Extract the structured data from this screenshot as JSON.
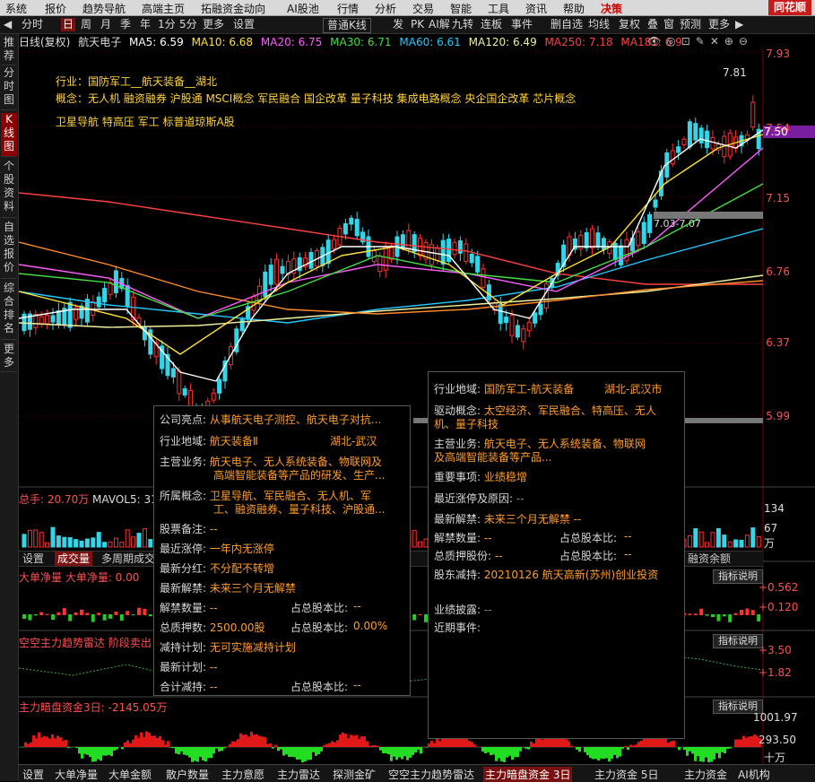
{
  "menu": [
    "系统",
    "报价",
    "趋势导航",
    "高端主页",
    "拓融资金动向",
    "AI股池",
    "行情",
    "分析",
    "交易",
    "智能",
    "工具",
    "资讯",
    "帮助",
    "决策"
  ],
  "brand": "同花顺",
  "toolbar": {
    "items": [
      "分时",
      "日",
      "周",
      "月",
      "季",
      "年",
      "1分",
      "5分",
      "更多",
      "设置"
    ],
    "active": "日",
    "right_items": [
      "普通K线",
      "发",
      "PK",
      "AI解",
      "九转",
      "连板",
      "事件",
      "删自选",
      "均线",
      "复权",
      "叠",
      "窗",
      "预测",
      "更多"
    ]
  },
  "left_tabs": [
    "推荐",
    "分时图",
    "K线图",
    "个股资料",
    "自选报价",
    "综合排名",
    "更多"
  ],
  "left_tabs_active": "K线图",
  "chart_header": {
    "mode": "日线(复权)",
    "name": "航天电子",
    "ma5": "MA5: 6.59",
    "ma10": "MA10: 6.68",
    "ma20": "MA20: 6.75",
    "ma30": "MA30: 6.71",
    "ma60": "MA60: 6.61",
    "ma120": "MA120: 6.49",
    "ma250": "MA250: 7.18",
    "ma181": "MA181: 6.9"
  },
  "industry_line": "行业：国防军工__航天装备__湖北",
  "concept_line": "概念：无人机  融资融券  沪股通  MSCI概念  军民融合  国企改革  量子科技  集成电路概念  央企国企改革  芯片概念",
  "concept_line2": "卫星导航  特高压  军工  标普道琼斯A股",
  "price_axis": [
    "7.93",
    "7.54",
    "7.15",
    "6.76",
    "6.37",
    "5.99"
  ],
  "price_tag": "7.50",
  "high_label": "7.81",
  "range_label": "7.03-7.07",
  "volume_label": "总手: 20.70万",
  "mavol": "MAVOL5: 31",
  "vol_axis": [
    "134",
    "67",
    "万"
  ],
  "mid_tabs": [
    "设置",
    "成交量",
    "多周期成交",
    "融资余额"
  ],
  "big_net": "大单净量  大单净量: 0.00",
  "big_net_axis": [
    "+0.562",
    "+0.120"
  ],
  "radar": "空空主力趋势雷达  阶段卖出",
  "radar_axis": [
    "+3.50",
    "+1.82"
  ],
  "dark_funds": "主力暗盘资金3日: -2145.05万",
  "dark_axis": [
    "1001.97",
    "293.50",
    "十万"
  ],
  "explain_label": "指标说明",
  "bottom_tabs": [
    "设置",
    "大单净量",
    "大单金额",
    "散户数量",
    "主力意愿",
    "主力雷达",
    "探测金矿",
    "空空主力趋势雷达",
    "主力暗盘资金 3日",
    "主力资金 5日",
    "主力资金",
    "AI机构"
  ],
  "bottom_active": "主力暗盘资金 3日",
  "panel_left": {
    "rows": [
      {
        "k": "公司亮点:",
        "v": "从事航天电子测控、航天电子对抗..."
      },
      {
        "k": "行业地域:",
        "v": "航天装备Ⅱ",
        "v2": "湖北-武汉"
      },
      {
        "k": "主营业务:",
        "v": "航天电子、无人系统装备、物联网及",
        "v3": "高端智能装备等产品的研发、生产..."
      },
      {
        "k": "所属概念:",
        "v": "卫星导航、军民融合、无人机、军",
        "v3": "工、融资融券、量子科技、沪股通..."
      },
      {
        "k": "股票备注:",
        "v": "--"
      },
      {
        "k": "最近涨停:",
        "v": "一年内无涨停"
      },
      {
        "k": "最新分红:",
        "v": "不分配不转增"
      },
      {
        "k": "最新解禁:",
        "v": "未来三个月无解禁"
      },
      {
        "k": "解禁数量:",
        "v": "--",
        "k2": "占总股本比:",
        "v2": "--"
      },
      {
        "k": "总质押数:",
        "v": "2500.00股",
        "k2": "占总股本比:",
        "v2": "0.00%"
      },
      {
        "k": "减持计划:",
        "v": "无可实施减持计划"
      },
      {
        "k": "最新计划:",
        "v": "--"
      },
      {
        "k": "合计减持:",
        "v": "--",
        "k2": "占总股本比:",
        "v2": "--"
      }
    ]
  },
  "panel_right": {
    "rows": [
      {
        "k": "行业地域:",
        "v": "国防军工-航天装备",
        "v2": "湖北-武汉市"
      },
      {
        "k": "驱动概念:",
        "v": "太空经济、军民融合、特高压、无人",
        "v3": "机、量子科技"
      },
      {
        "k": "主营业务:",
        "v": "航天电子、无人系统装备、物联网",
        "v3": "及高端智能装备等产品..."
      },
      {
        "k": "重要事项:",
        "v": "业绩稳增"
      },
      {
        "k": "最近涨停及原因:",
        "v": "--"
      },
      {
        "k": "最新解禁:",
        "v": "未来三个月无解禁 --"
      },
      {
        "k": "解禁数量:",
        "v": "--",
        "k2": "占总股本比:",
        "v2": "--"
      },
      {
        "k": "总质押股份:",
        "v": "--",
        "k2": "占总股本比:",
        "v2": "--"
      },
      {
        "k": "股东减持:",
        "v": "20210126 航天高新(苏州)创业投资"
      },
      {
        "k": "业绩披露:",
        "v": "--"
      },
      {
        "k": "近期事件:",
        "v": ""
      }
    ]
  },
  "colors": {
    "up": "#ff3030",
    "down": "#33d6e8",
    "ma5": "#ffffff",
    "ma10": "#ffe135",
    "ma20": "#ff5cff",
    "ma30": "#44dd44",
    "ma60": "#22c8ff",
    "ma120": "#f0f0a0",
    "ma250": "#ff4040"
  }
}
